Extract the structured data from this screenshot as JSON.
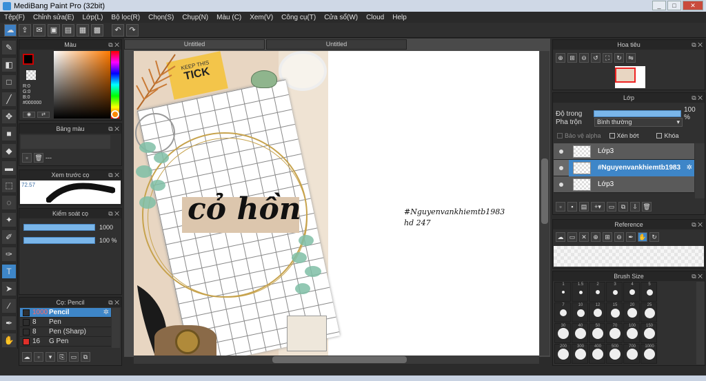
{
  "window": {
    "title": "MediBang Paint Pro (32bit)",
    "min": "_",
    "max": "□",
    "close": "✕"
  },
  "menu": [
    "Tệp(F)",
    "Chỉnh sửa(E)",
    "Lớp(L)",
    "Bộ lọc(R)",
    "Chọn(S)",
    "Chụp(N)",
    "Màu (C)",
    "Xem(V)",
    "Công cụ(T)",
    "Cửa sổ(W)",
    "Cloud",
    "Help"
  ],
  "tabs": [
    "Untitled",
    "Untitled"
  ],
  "color_panel": {
    "title": "Màu",
    "r": "R:0",
    "g": "G:0",
    "b": "B:0",
    "hex": "#000000",
    "primary": "#000000"
  },
  "palette_panel": {
    "title": "Bảng màu",
    "value": "---"
  },
  "brush_preview": {
    "title": "Xem trước cọ",
    "size": "72.57"
  },
  "brush_control": {
    "title": "Kiểm soát cọ",
    "size": "1000",
    "opacity": "100 %",
    "opacity_pct": 100
  },
  "brush_list": {
    "title": "Cọ: Pencil",
    "items": [
      {
        "size": "1000",
        "name": "Pencil",
        "color": "#2e2e2e",
        "selected": true
      },
      {
        "size": "8",
        "name": "Pen",
        "color": "#2e2e2e"
      },
      {
        "size": "8",
        "name": "Pen (Sharp)",
        "color": "#2e2e2e"
      },
      {
        "size": "16",
        "name": "G Pen",
        "color": "#e0302a"
      }
    ]
  },
  "navigator": {
    "title": "Hoa tiêu"
  },
  "layers": {
    "title": "Lớp",
    "opacity_label": "Độ trong",
    "opacity_value": "100 %",
    "opacity_pct": 100,
    "blend_label": "Pha trộn",
    "blend_value": "Bình thường",
    "protect_alpha": "Bảo vệ alpha",
    "clipping": "Xén bớt",
    "lock": "Khóa",
    "items": [
      {
        "name": "Lớp3",
        "selected": false
      },
      {
        "name": "#Nguyenvankhiemtb1983",
        "selected": true
      },
      {
        "name": "Lớp3",
        "selected": false
      }
    ]
  },
  "reference": {
    "title": "Reference"
  },
  "brush_size": {
    "title": "Brush Size",
    "labels": [
      "1",
      "1.5",
      "2",
      "3",
      "4",
      "5",
      "7",
      "10",
      "12",
      "15",
      "20",
      "25",
      "30",
      "40",
      "50",
      "70",
      "100",
      "150",
      "200",
      "300",
      "400",
      "500",
      "700",
      "1000"
    ]
  },
  "canvas": {
    "title_text": "cỏ hồn",
    "text_line1": "#Nguyenvankhiemtb1983",
    "text_line2": "hd 247",
    "stamp_text": "KEEP THIS",
    "ticket_text": "TICK"
  }
}
